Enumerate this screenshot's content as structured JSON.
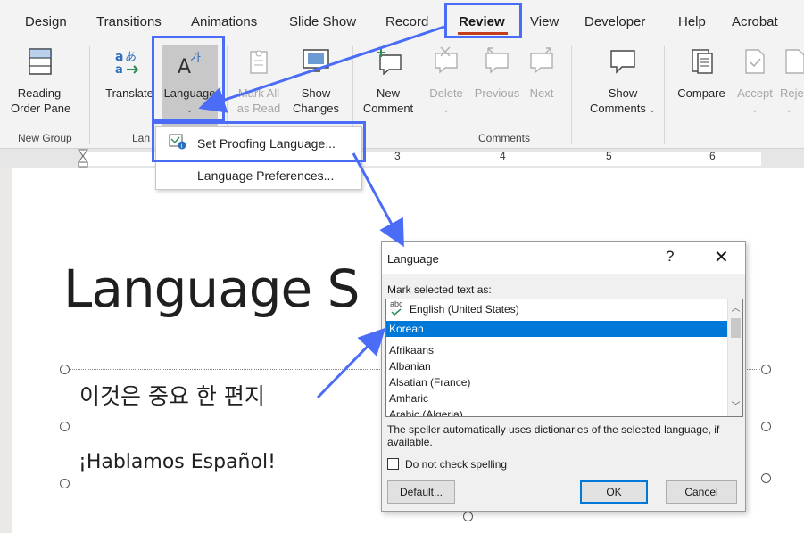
{
  "tabs": [
    {
      "label": "Design"
    },
    {
      "label": "Transitions"
    },
    {
      "label": "Animations"
    },
    {
      "label": "Slide Show"
    },
    {
      "label": "Record"
    },
    {
      "label": "Review"
    },
    {
      "label": "View"
    },
    {
      "label": "Developer"
    },
    {
      "label": "Help"
    },
    {
      "label": "Acrobat"
    }
  ],
  "ribbon": {
    "reading_order_pane": {
      "line1": "Reading",
      "line2": "Order Pane"
    },
    "translate": "Translate",
    "language": "Language",
    "mark_all_as_read": {
      "line1": "Mark All",
      "line2": "as Read"
    },
    "show_changes": {
      "line1": "Show",
      "line2": "Changes"
    },
    "new_comment": {
      "line1": "New",
      "line2": "Comment"
    },
    "delete": "Delete",
    "previous": "Previous",
    "next": "Next",
    "show_comments": {
      "line1": "Show",
      "line2": "Comments"
    },
    "compare": "Compare",
    "accept": "Accept",
    "reject_partial": "Reje",
    "groups": {
      "new_group": "New Group",
      "language_partial": "Lan",
      "comments": "Comments"
    }
  },
  "ruler": {
    "numbers": [
      "3",
      "4",
      "5",
      "6"
    ]
  },
  "dropdown": {
    "set_proofing_language": "Set Proofing Language...",
    "language_preferences": "Language Preferences..."
  },
  "slide": {
    "title": "Language S",
    "korean_text": "이것은 중요 한 편지",
    "spanish_text": "¡Hablamos Español!"
  },
  "dialog": {
    "title": "Language",
    "help": "?",
    "close": "✕",
    "mark_label": "Mark selected text as:",
    "languages": [
      {
        "name": "English (United States)",
        "checked": true,
        "selected": false
      },
      {
        "name": "Korean",
        "checked": false,
        "selected": true
      },
      {
        "name": "Afrikaans",
        "checked": false,
        "selected": false
      },
      {
        "name": "Albanian",
        "checked": false,
        "selected": false
      },
      {
        "name": "Alsatian (France)",
        "checked": false,
        "selected": false
      },
      {
        "name": "Amharic",
        "checked": false,
        "selected": false
      },
      {
        "name": "Arabic (Algeria)",
        "checked": false,
        "selected": false
      }
    ],
    "abc_mark": "abc",
    "note": "The speller automatically uses dictionaries of the selected language, if available.",
    "do_not_check": "Do not check spelling",
    "do_not_check_checked": false,
    "default_button": "Default...",
    "ok_button": "OK",
    "cancel_button": "Cancel"
  },
  "colors": {
    "accent_highlight": "#4a6cf7",
    "review_underline": "#c43e1c",
    "selection_blue": "#0078d7"
  }
}
